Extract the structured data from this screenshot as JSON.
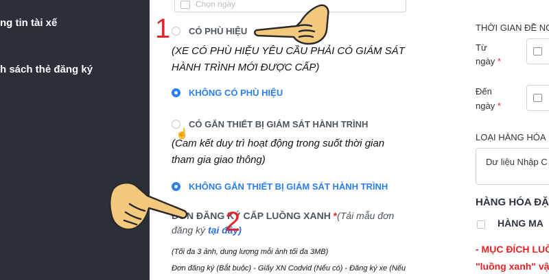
{
  "sidebar": {
    "items": [
      {
        "label": "ng tin tài xế"
      },
      {
        "label": "h sách thẻ đăng ký"
      }
    ]
  },
  "form": {
    "date_placeholder": "Chọn ngày",
    "options": [
      {
        "label": "CÓ PHÙ HIỆU",
        "selected": false
      },
      {
        "label": "KHÔNG CÓ PHÙ HIỆU",
        "selected": true
      },
      {
        "label": "CÓ GẮN THIẾT BỊ GIÁM SÁT HÀNH TRÌNH",
        "selected": false
      },
      {
        "label": "KHÔNG GẮN THIẾT BỊ GIÁM SÁT HÀNH TRÌNH",
        "selected": true
      }
    ],
    "note1": "(XE CÓ PHÙ HIỆU YÊU CẦU PHẢI CÓ GIÁM SÁT HÀNH TRÌNH MỚI ĐƯỢC CẤP)",
    "note2": "(Cam kết duy trì hoạt động trong suốt thời gian tham gia giao thông)",
    "register_label": "ĐƠN ĐĂNG KÝ CẤP LUỒNG XANH",
    "register_required": "*",
    "register_hint": "(Tải mẫu đơn đăng ký",
    "register_link": "tại đây)",
    "upload_limit": "(Tối đa 3 ảnh, dung lượng mỗi ảnh tối đa 3MB)",
    "documents": "Đơn đăng ký (Bắt buộc) - Giấy XN Codvid (Nếu có) - Đăng ký xe (Nếu"
  },
  "annotations": {
    "step1": "1",
    "step2": "2"
  },
  "right_panel": {
    "time_label": "THỜI GIAN ĐỀ NG",
    "from_label": "Từ",
    "from_label2": "ngày",
    "to_label": "Đến",
    "to_label2": "ngày",
    "required": "*",
    "cargo_type_label": "LOẠI HÀNG HÓA",
    "cargo_placeholder": "Dư liệu Nhập C",
    "special_cargo_heading": "HÀNG HÓA ĐẶ",
    "special_cargo_option": "HÀNG MA",
    "purpose_heading": "- MỤC ĐÍCH LUỒ",
    "purpose_sub": "\"luồng xanh\" vậ"
  },
  "colors": {
    "sidebar_bg": "#2a2f3a",
    "accent_blue": "#2b7ff0",
    "annotation_red": "#e3262b",
    "hand_fill": "#f3c97d"
  }
}
